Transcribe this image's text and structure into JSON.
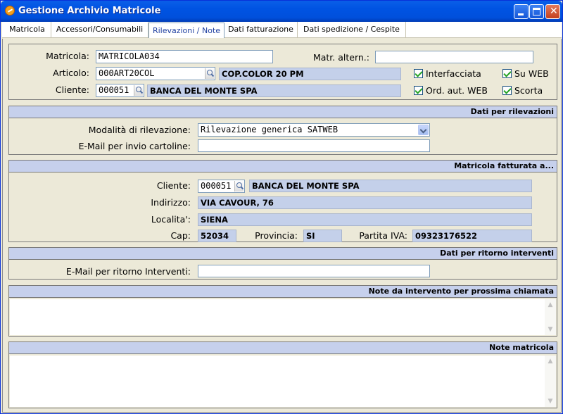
{
  "window": {
    "title": "Gestione Archivio Matricole"
  },
  "tabs": [
    {
      "label": "Matricola"
    },
    {
      "label": "Accessori/Consumabili"
    },
    {
      "label": "Rilevazioni / Note"
    },
    {
      "label": "Dati fatturazione"
    },
    {
      "label": "Dati spedizione / Cespite"
    }
  ],
  "active_tab": "Rilevazioni / Note",
  "header": {
    "matricola_label": "Matricola:",
    "matricola_value": "MATRICOLA034",
    "matr_altern_label": "Matr. altern.:",
    "matr_altern_value": "",
    "articolo_label": "Articolo:",
    "articolo_code": "000ART20COL",
    "articolo_desc": "COP.COLOR 20 PM",
    "cliente_label": "Cliente:",
    "cliente_code": "000051",
    "cliente_desc": "BANCA DEL MONTE SPA",
    "checkboxes": {
      "interfacciata": {
        "label": "Interfacciata",
        "checked": true
      },
      "su_web": {
        "label": "Su WEB",
        "checked": true
      },
      "ord_aut_web": {
        "label": "Ord. aut. WEB",
        "checked": true
      },
      "scorta": {
        "label": "Scorta",
        "checked": true
      }
    }
  },
  "rilevazioni": {
    "title": "Dati per rilevazioni",
    "modalita_label": "Modalità di rilevazione:",
    "modalita_value": "Rilevazione generica SATWEB",
    "email_label": "E-Mail per invio cartoline:",
    "email_value": ""
  },
  "fatturata": {
    "title": "Matricola fatturata a...",
    "cliente_label": "Cliente:",
    "cliente_code": "000051",
    "cliente_desc": "BANCA DEL MONTE SPA",
    "indirizzo_label": "Indirizzo:",
    "indirizzo_value": "VIA CAVOUR, 76",
    "localita_label": "Localita':",
    "localita_value": "SIENA",
    "cap_label": "Cap:",
    "cap_value": "52034",
    "provincia_label": "Provincia:",
    "provincia_value": "SI",
    "piva_label": "Partita IVA:",
    "piva_value": "09323176522"
  },
  "ritorno": {
    "title": "Dati per ritorno interventi",
    "email_label": "E-Mail per ritorno Interventi:",
    "email_value": ""
  },
  "note_intervento": {
    "title": "Note da intervento per prossima chiamata",
    "value": ""
  },
  "note_matricola": {
    "title": "Note matricola",
    "value": ""
  },
  "colors": {
    "titlebar": "#0054e3",
    "panel_header": "#c6d0ec",
    "readonly_field": "#c4d0ea",
    "face": "#ece9d8"
  },
  "icons": [
    "app-icon",
    "minimize-icon",
    "maximize-icon",
    "close-icon",
    "lookup-icon",
    "dropdown-arrow-icon",
    "checkmark-icon"
  ]
}
